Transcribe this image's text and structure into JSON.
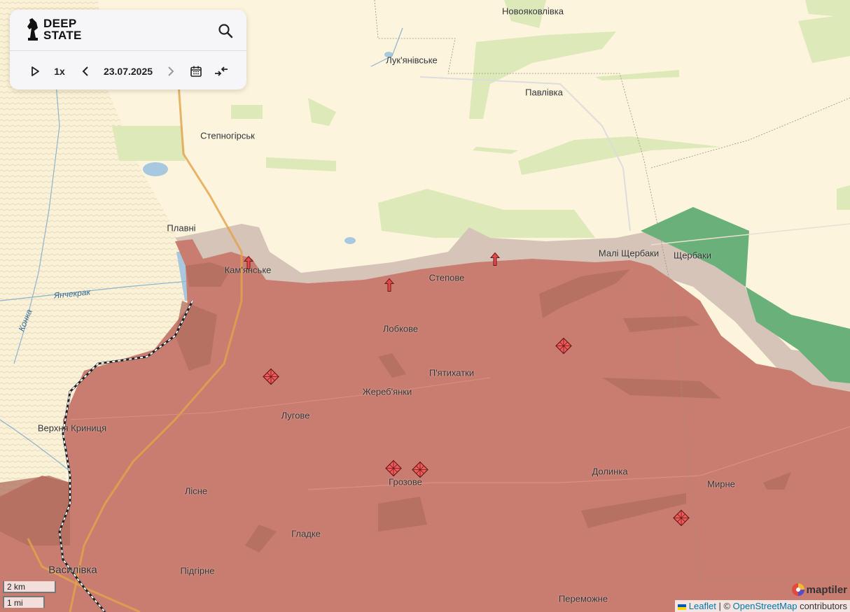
{
  "app": {
    "logo_text": "DEEP\nSTATE"
  },
  "controls": {
    "speed": "1x",
    "date": "23.07.2025"
  },
  "places": {
    "novoyakovlivka": "Новояковлівка",
    "lukianivske": "Лук'янівське",
    "pavlivka": "Павлівка",
    "stepnohirsk": "Степногірськ",
    "plavni": "Плавні",
    "kamianske": "Кам'янське",
    "stepove": "Степове",
    "mali_shcherbaky": "Малі Щербаки",
    "shcherbaky": "Щербаки",
    "lobkove": "Лобкове",
    "piatykhatky": "П'ятихатки",
    "zherebianky": "Жереб'янки",
    "luhove": "Лугове",
    "verkhnia_krynytsia": "Верхня Криниця",
    "hrozove": "Грозове",
    "dolynka": "Долинка",
    "myrne": "Мирне",
    "lisne": "Лісне",
    "hladke": "Гладке",
    "vasylivka": "Василівка",
    "pidhirne": "Підгірне",
    "peremozhne": "Переможне",
    "yanchekrak": "Янчекрак",
    "konka": "Конка"
  },
  "scale": {
    "km": "2 km",
    "mi": "1 mi"
  },
  "attribution": {
    "leaflet": "Leaflet",
    "separator": "| ©",
    "osm": "OpenStreetMap",
    "contributors": "contributors",
    "maptiler": "maptiler"
  },
  "colors": {
    "occupied": "#c97d70",
    "contested": "#d6c4b8",
    "liberated": "#6ab07a",
    "fields": "#dde9b8",
    "water": "#a8c8df",
    "base": "#fcf4dc"
  },
  "icons": {
    "attack_arrow": "red-up-arrow-icon",
    "shelling": "red-diamond-grid-icon"
  }
}
